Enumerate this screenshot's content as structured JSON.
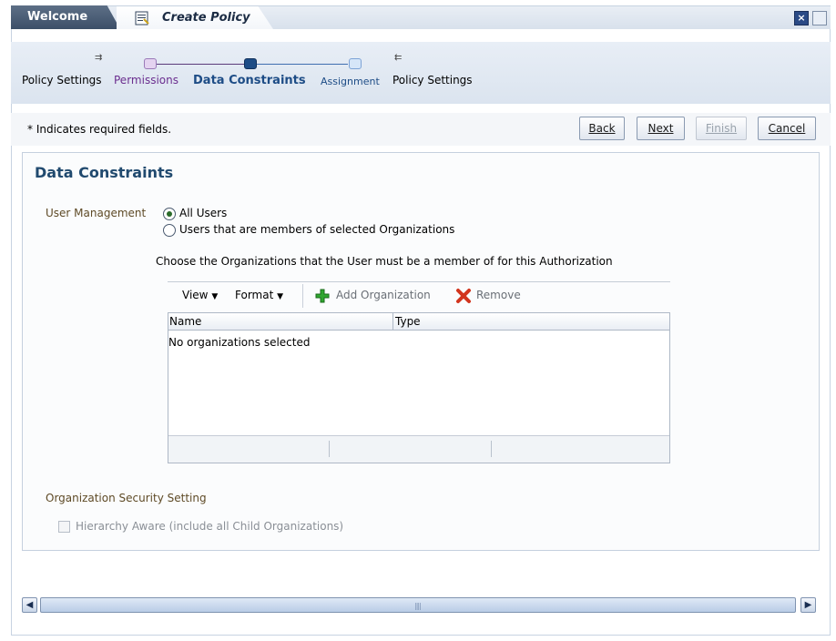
{
  "tabs": {
    "welcome": "Welcome",
    "create_policy": "Create Policy"
  },
  "window": {
    "close_glyph": "×"
  },
  "train": {
    "stops": [
      {
        "label": "Policy Settings",
        "state": "visited"
      },
      {
        "label": "Permissions",
        "state": "visited"
      },
      {
        "label": "Data Constraints",
        "state": "current"
      },
      {
        "label": "Assignment",
        "state": "unvisited"
      },
      {
        "label": "Policy Settings",
        "state": "unvisited"
      }
    ]
  },
  "toolbar": {
    "required_note": "* Indicates required fields.",
    "back": "Back",
    "next": "Next",
    "finish": "Finish",
    "cancel": "Cancel"
  },
  "section": {
    "title": "Data Constraints",
    "user_mgmt_label": "User Management",
    "radio_all": "All Users",
    "radio_members": "Users that are members of selected Organizations",
    "selected_radio": "All Users",
    "hint": "Choose the Organizations that the User must be a member of for this Authorization"
  },
  "table": {
    "view_menu": "View",
    "format_menu": "Format",
    "add": "Add Organization",
    "remove": "Remove",
    "columns": [
      "Name",
      "Type"
    ],
    "empty_message": "No organizations selected"
  },
  "security": {
    "label": "Organization Security Setting",
    "checkbox": "Hierarchy Aware (include all Child Organizations)",
    "checked": false
  },
  "colors": {
    "train_visited": "#e4d3f0",
    "train_current": "#1d4c86",
    "train_unvisited": "#d6e6f8",
    "accent_label": "#5e4a26",
    "title": "#214a6f"
  }
}
